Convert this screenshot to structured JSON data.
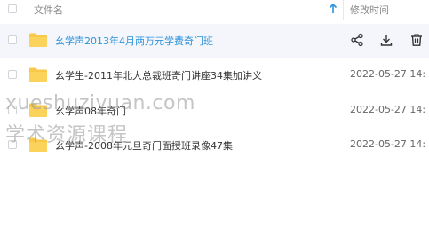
{
  "header": {
    "name_label": "文件名",
    "time_label": "修改时间",
    "sort_icon": "arrow-up-icon"
  },
  "colors": {
    "accent": "#2e93d8",
    "folder": "#f7c84a",
    "hover_row": "#f4f6fb"
  },
  "files": [
    {
      "name": "幺学声2013年4月两万元学费奇门班",
      "time": "",
      "selected_hover": true
    },
    {
      "name": "幺学生-2011年北大总裁班奇门讲座34集加讲义",
      "time": "2022-05-27 14:"
    },
    {
      "name": "幺学声08年奇门",
      "time": "2022-05-27 14:"
    },
    {
      "name": "幺学声-2008年元旦奇门面授班录像47集",
      "time": "2022-05-27 14:"
    }
  ],
  "row_actions": [
    "share-icon",
    "download-icon",
    "delete-icon"
  ],
  "watermark": {
    "line1": "xueshuziyuan.com",
    "line2": "学术资源课程"
  }
}
